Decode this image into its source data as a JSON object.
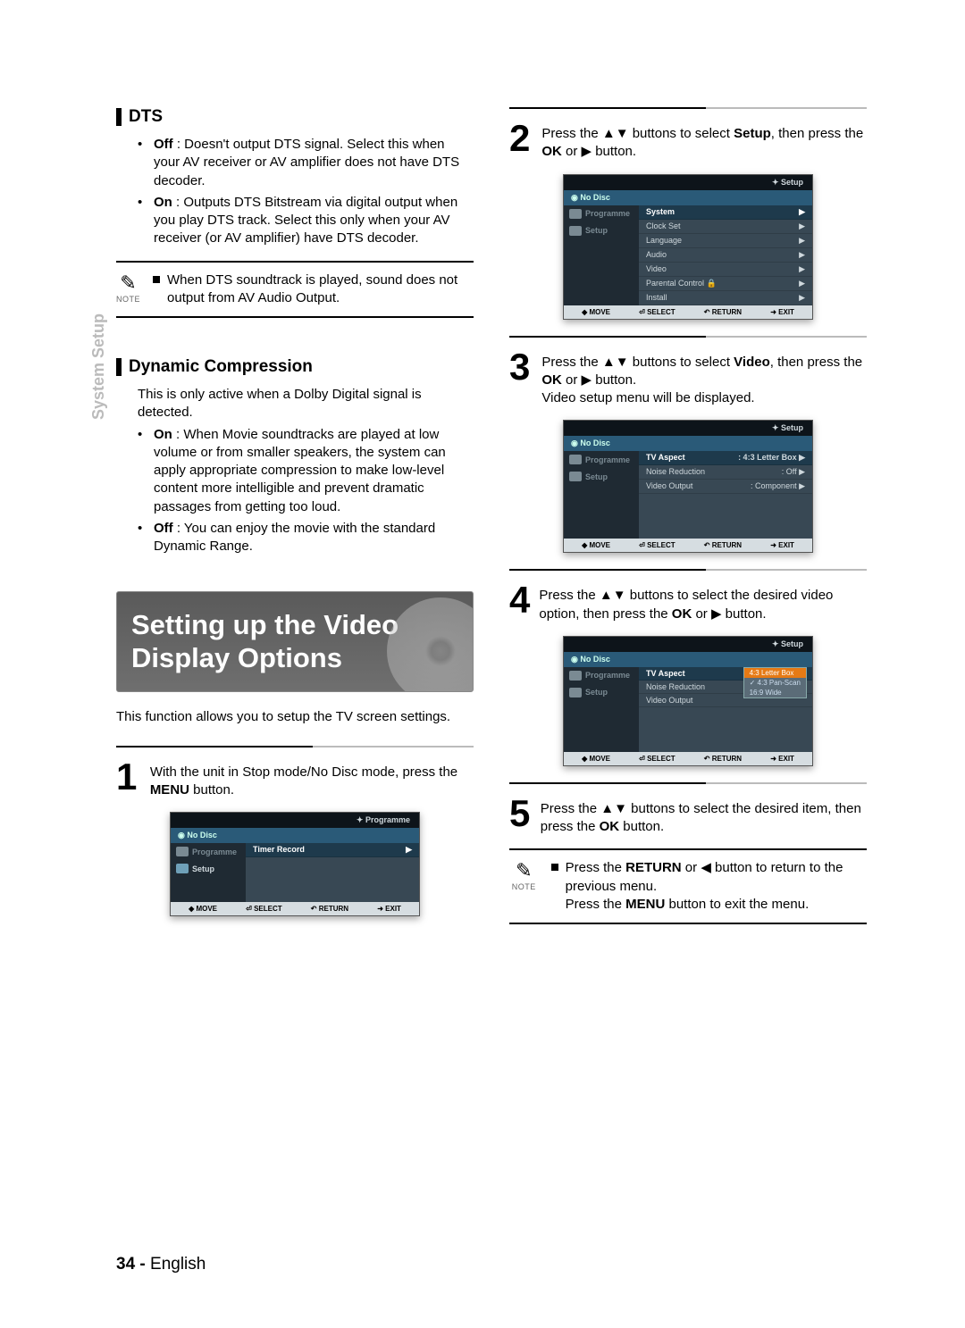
{
  "side_tab": "System Setup",
  "dts": {
    "title": "DTS",
    "off_label": "Off",
    "off_text": ": Doesn't output DTS signal. Select this when your AV receiver or AV amplifier does not have DTS decoder.",
    "on_label": "On",
    "on_text": ": Outputs DTS Bitstream via digital output when you play DTS track. Select this only when your AV receiver (or AV amplifier) have DTS decoder.",
    "note_label": "NOTE",
    "note_text": "When DTS soundtrack is played, sound does not output from AV Audio Output."
  },
  "dyn": {
    "title": "Dynamic Compression",
    "intro": "This is only active when a Dolby Digital signal is detected.",
    "on_label": "On",
    "on_text": ": When Movie soundtracks are played at low volume or from smaller speakers, the system can apply appropriate compression to make low-level content more intelligible and prevent dramatic passages from getting too loud.",
    "off_label": "Off",
    "off_text": ": You can enjoy the movie with the standard Dynamic Range."
  },
  "video_header": "Setting up the Video Display Options",
  "video_intro": "This function allows you to setup the TV screen settings.",
  "steps": {
    "s1a": "With the unit in Stop mode/No Disc mode, press the ",
    "s1b": "MENU",
    "s1c": " button.",
    "s2a": "Press the ▲▼ buttons to select ",
    "s2b": "Setup",
    "s2c": ", then press the ",
    "s2d": "OK",
    "s2e": " or ▶ button.",
    "s3a": "Press the ▲▼ buttons to select ",
    "s3b": "Video",
    "s3c": ", then press the ",
    "s3d": "OK",
    "s3e": " or ▶ button.",
    "s3f": "Video setup menu will be displayed.",
    "s4a": "Press the ▲▼ buttons to select the desired video option, then press the ",
    "s4b": "OK",
    "s4c": " or ▶ button.",
    "s5": "Press the ▲▼ buttons to select the desired item, then press the ",
    "s5b": "OK",
    "s5c": " button."
  },
  "final_note": {
    "label": "NOTE",
    "l1a": "Press the ",
    "l1b": "RETURN",
    "l1c": " or ◀ button to return to the previous menu.",
    "l2a": "Press the ",
    "l2b": "MENU",
    "l2c": " button to exit the menu."
  },
  "osd_common": {
    "nodisc": "No Disc",
    "programme": "Programme",
    "setup": "Setup",
    "move": "MOVE",
    "select": "SELECT",
    "return": "RETURN",
    "exit": "EXIT"
  },
  "osd1": {
    "title": "Programme",
    "item": "Timer Record"
  },
  "osd2": {
    "title": "Setup",
    "items": [
      "System",
      "Clock Set",
      "Language",
      "Audio",
      "Video",
      "Parental Control",
      "Install"
    ]
  },
  "osd3": {
    "title": "Setup",
    "rows": [
      {
        "k": "TV Aspect",
        "v": ": 4:3 Letter Box",
        "sel": true
      },
      {
        "k": "Noise Reduction",
        "v": ": Off"
      },
      {
        "k": "Video Output",
        "v": ": Component"
      }
    ]
  },
  "osd4": {
    "title": "Setup",
    "rows": [
      "TV Aspect",
      "Noise Reduction",
      "Video Output"
    ],
    "popup": [
      "4:3 Letter Box",
      "✓ 4:3 Pan-Scan",
      "16:9 Wide"
    ]
  },
  "footer": {
    "page": "34 -",
    "lang": "English"
  }
}
